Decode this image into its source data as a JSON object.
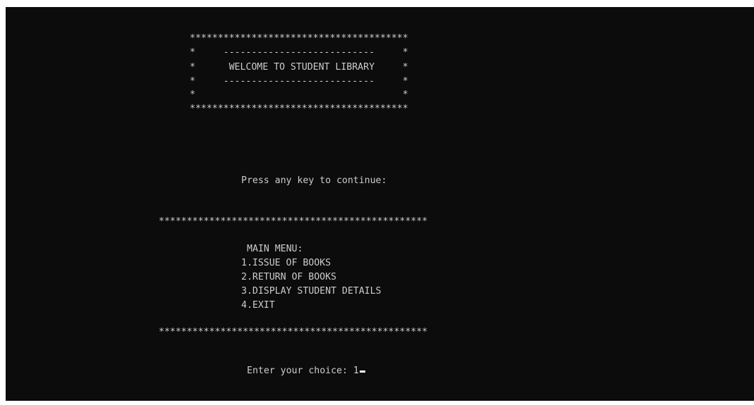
{
  "banner": {
    "top_border": "***************************************",
    "line_1": "*     ---------------------------     *",
    "line_2": "*      WELCOME TO STUDENT LIBRARY     *",
    "line_3": "*     ---------------------------     *",
    "line_4": "*                                     *",
    "bottom_border": "***************************************"
  },
  "prompt_continue": "Press any key to continue:",
  "menu": {
    "top_separator": "************************************************",
    "title": "MAIN MENU:",
    "options": [
      "1.ISSUE OF BOOKS",
      "2.RETURN OF BOOKS",
      "3.DISPLAY STUDENT DETAILS",
      "4.EXIT"
    ],
    "bottom_separator": "************************************************"
  },
  "choice_prompt": "Enter your choice: ",
  "choice_value": "1"
}
